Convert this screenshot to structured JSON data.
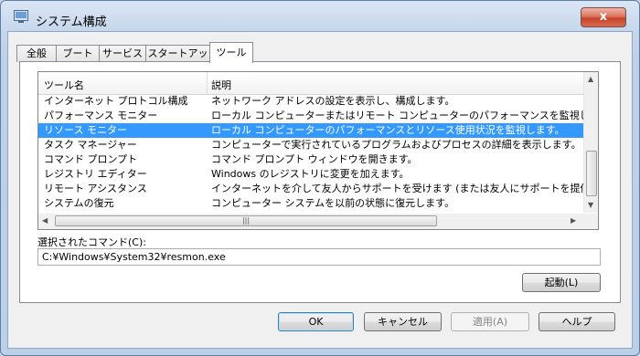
{
  "window": {
    "title": "システム構成",
    "close_label": "x"
  },
  "tabs": [
    {
      "label": "全般"
    },
    {
      "label": "ブート"
    },
    {
      "label": "サービス"
    },
    {
      "label": "スタートアップ"
    },
    {
      "label": "ツール",
      "active": true
    }
  ],
  "list": {
    "headers": [
      "ツール名",
      "説明"
    ],
    "rows": [
      {
        "name": "インターネット プロトコル構成",
        "desc": "ネットワーク アドレスの設定を表示し、構成します。"
      },
      {
        "name": "パフォーマンス モニター",
        "desc": "ローカル コンピューターまたはリモート コンピューターのパフォーマンスを監視します。"
      },
      {
        "name": "リソース モニター",
        "desc": "ローカル コンピューターのパフォーマンスとリソース使用状況を監視します。",
        "selected": true
      },
      {
        "name": "タスク マネージャー",
        "desc": "コンピューターで実行されているプログラムおよびプロセスの詳細を表示します。"
      },
      {
        "name": "コマンド プロンプト",
        "desc": "コマンド プロンプト ウィンドウを開きます。"
      },
      {
        "name": "レジストリ エディター",
        "desc": "Windows のレジストリに変更を加えます。"
      },
      {
        "name": "リモート アシスタンス",
        "desc": "インターネットを介して友人からサポートを受けます (または友人にサポートを提供します)。"
      },
      {
        "name": "システムの復元",
        "desc": "コンピューター システムを以前の状態に復元します。"
      }
    ]
  },
  "command": {
    "label": "選択されたコマンド(C):",
    "value": "C:¥Windows¥System32¥resmon.exe"
  },
  "buttons": {
    "launch": "起動(L)",
    "ok": "OK",
    "cancel": "キャンセル",
    "apply": "適用(A)",
    "help": "ヘルプ"
  },
  "colors": {
    "selection": "#3399ff",
    "close_button": "#c5432a"
  }
}
